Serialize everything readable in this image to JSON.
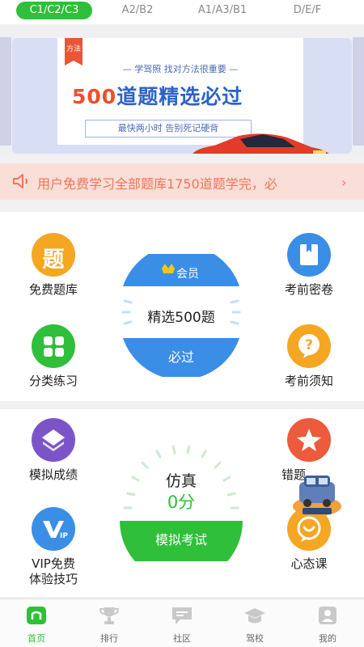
{
  "license_tabs": [
    {
      "label": "C1/C2/C3",
      "active": true
    },
    {
      "label": "A2/B2",
      "active": false
    },
    {
      "label": "A1/A3/B1",
      "active": false
    },
    {
      "label": "D/E/F",
      "active": false
    }
  ],
  "banner": {
    "ribbon": "方法",
    "line1": "— 学驾照 找对方法很重要 —",
    "title_num": "500",
    "title_text": "道题精选必过",
    "subtitle": "最快两小时 告别死记硬背",
    "active_slide": 2,
    "slide_count": 2
  },
  "notice": {
    "text": "用户免费学习全部题库1750道题学完，必",
    "icon": "speaker-icon",
    "arrow": "›"
  },
  "section1": {
    "left": [
      {
        "label": "免费题库",
        "icon": "question-bank-icon",
        "glyph": "题",
        "color": "#f5a623"
      },
      {
        "label": "分类练习",
        "icon": "grid-icon",
        "color": "#2fbf3a"
      }
    ],
    "right": [
      {
        "label": "考前密卷",
        "icon": "sealed-paper-icon",
        "color": "#3a8ee6"
      },
      {
        "label": "考前须知",
        "icon": "question-bubble-icon",
        "glyph": "?",
        "color": "#f5a623"
      }
    ],
    "center": {
      "badge": "会员",
      "text": "精选500题",
      "button": "必过"
    }
  },
  "section2": {
    "left": [
      {
        "label": "模拟成绩",
        "icon": "layers-icon",
        "color": "#7b55c8"
      },
      {
        "label": "VIP免费\n体验技巧",
        "line1": "VIP免费",
        "line2": "体验技巧",
        "icon": "vip-icon",
        "color": "#3a8ee6"
      }
    ],
    "right": [
      {
        "label": "错题集",
        "label_visible": "错题",
        "icon": "star-icon",
        "color": "#ee5a3c"
      },
      {
        "label": "心态课",
        "icon": "chat-heart-icon",
        "color": "#f5a623"
      }
    ],
    "center": {
      "title": "仿真",
      "score": "0分",
      "button": "模拟考试"
    }
  },
  "bottom_nav": [
    {
      "label": "首页",
      "icon": "home-icon",
      "active": true
    },
    {
      "label": "排行",
      "icon": "trophy-icon",
      "active": false
    },
    {
      "label": "社区",
      "icon": "chat-icon",
      "active": false
    },
    {
      "label": "驾校",
      "icon": "graduation-cap-icon",
      "active": false
    },
    {
      "label": "我的",
      "icon": "user-icon",
      "active": false
    }
  ],
  "colors": {
    "primary_green": "#2fbf3a",
    "accent_blue": "#3a8ee6",
    "accent_orange": "#f5a623",
    "notice_bg": "#fadfd8",
    "notice_text": "#f07458"
  }
}
